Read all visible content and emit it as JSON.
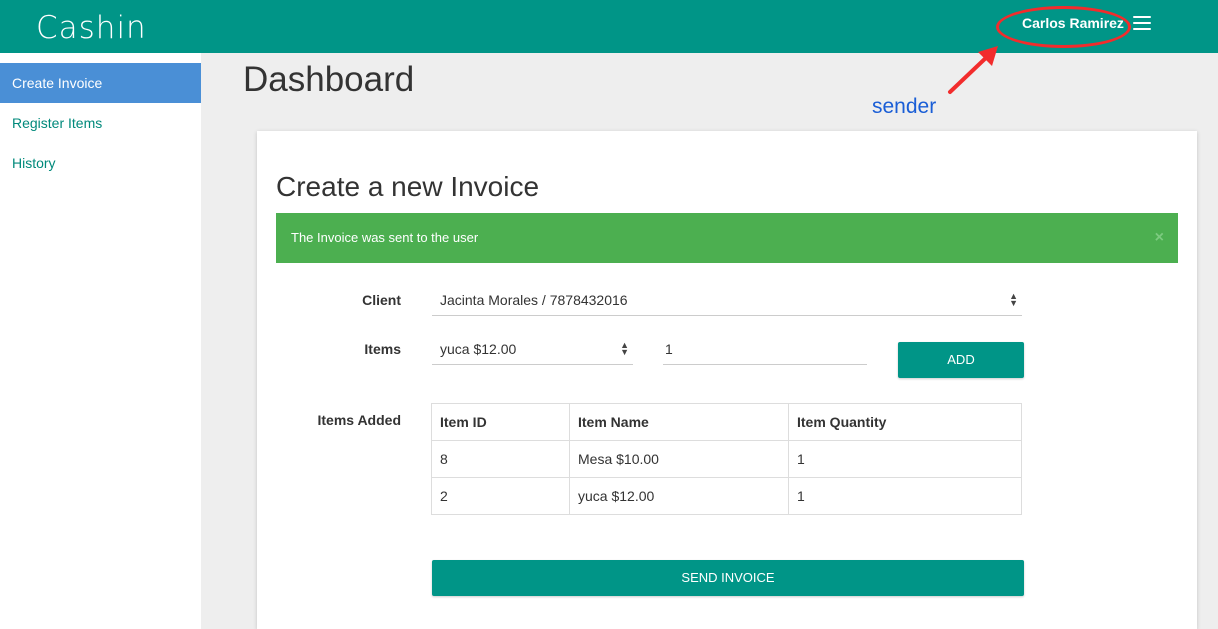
{
  "app": {
    "brand": "Cashin"
  },
  "header": {
    "user_name": "Carlos Ramirez"
  },
  "annotation": {
    "label": "sender"
  },
  "sidebar": {
    "items": [
      {
        "label": "Create Invoice"
      },
      {
        "label": "Register Items"
      },
      {
        "label": "History"
      }
    ]
  },
  "main": {
    "title": "Dashboard",
    "card_title": "Create a new Invoice",
    "alert": {
      "message": "The Invoice was sent to the user",
      "close": "×"
    },
    "form": {
      "client_label": "Client",
      "client_value": "Jacinta Morales / 7878432016",
      "items_label": "Items",
      "item_select_value": "yuca $12.00",
      "quantity_value": "1",
      "add_button": "ADD",
      "items_added_label": "Items Added",
      "send_button": "SEND INVOICE"
    },
    "table": {
      "headers": [
        "Item ID",
        "Item Name",
        "Item Quantity"
      ],
      "rows": [
        [
          "8",
          "Mesa $10.00",
          "1"
        ],
        [
          "2",
          "yuca $12.00",
          "1"
        ]
      ]
    }
  },
  "colors": {
    "primary": "#009587",
    "active": "#4a8fd6",
    "success": "#4caf50",
    "annotation_red": "#f22c2c",
    "annotation_blue": "#1a5ed6"
  }
}
